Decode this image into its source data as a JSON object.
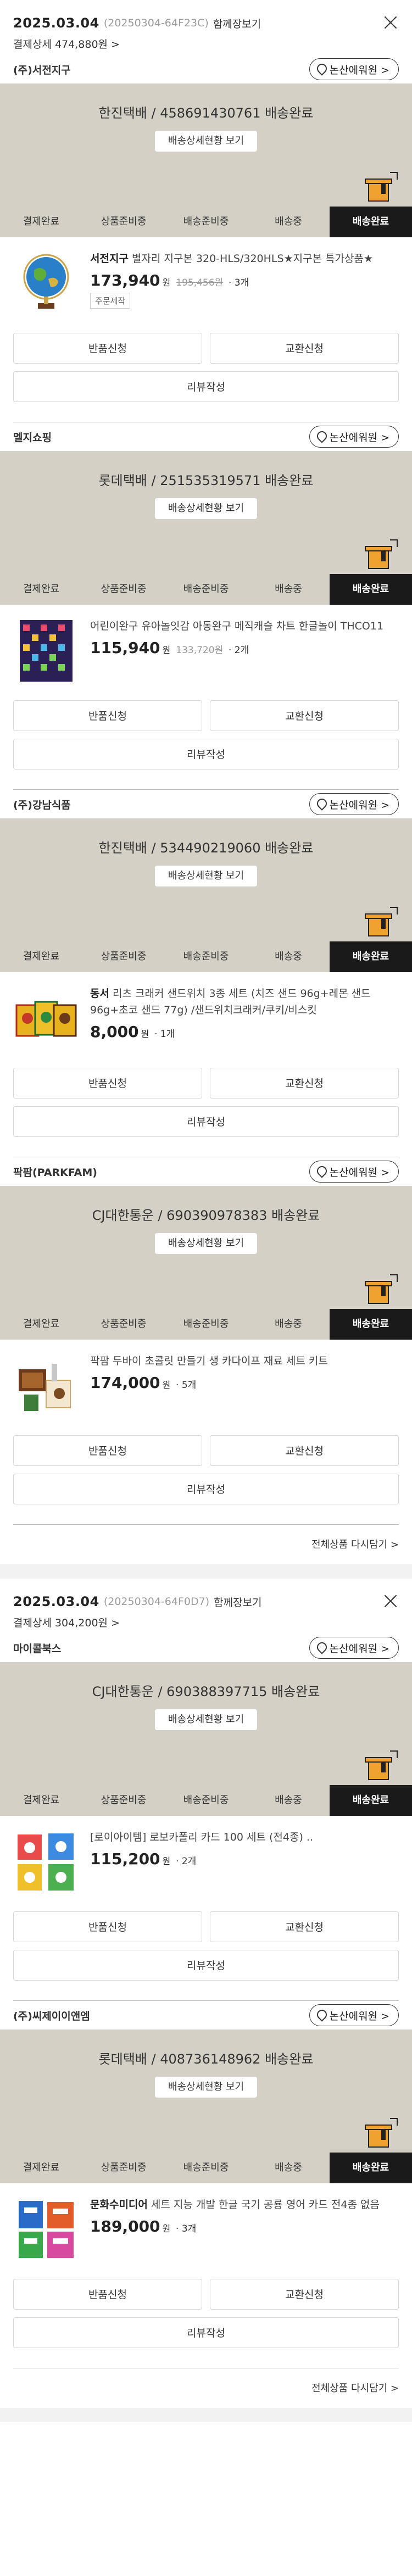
{
  "orders": [
    {
      "date": "2025.03.04",
      "number": "(20250304-64F23C)",
      "group_label": "함께장보기",
      "payment": "결제상세 474,880원 >",
      "more": "전체상품 다시담기 >",
      "sellers": [
        {
          "name": "(주)서전지구",
          "map": "논산에워원 >",
          "tracking": "한진택배 / 458691430761 배송완료",
          "track_btn": "배송상세현황 보기",
          "steps": [
            "결제완료",
            "상품준비중",
            "배송준비중",
            "배송중",
            "배송완료"
          ],
          "item": {
            "brand": "서전지구",
            "name": " 별자리 지구본 320-HLS/320HLS★지구본 특가상품★",
            "price": "173,940",
            "won": "원",
            "orig": "195,456원",
            "qty": "· 3개",
            "tag": "주문제작"
          },
          "buttons": [
            "반품신청",
            "교환신청",
            "리뷰작성"
          ]
        },
        {
          "name": "멜지쇼핑",
          "map": "논산에워원 >",
          "tracking": "롯데택배 / 251535319571 배송완료",
          "track_btn": "배송상세현황 보기",
          "steps": [
            "결제완료",
            "상품준비중",
            "배송준비중",
            "배송중",
            "배송완료"
          ],
          "item": {
            "brand": "",
            "name": "어린이완구 유아놀잇감 아동완구 메직캐슬 차트 한글놀이 THCO11",
            "price": "115,940",
            "won": "원",
            "orig": "133,720원",
            "qty": "· 2개",
            "tag": ""
          },
          "buttons": [
            "반품신청",
            "교환신청",
            "리뷰작성"
          ]
        },
        {
          "name": "(주)강남식품",
          "map": "논산에워원 >",
          "tracking": "한진택배 / 534490219060 배송완료",
          "track_btn": "배송상세현황 보기",
          "steps": [
            "결제완료",
            "상품준비중",
            "배송준비중",
            "배송중",
            "배송완료"
          ],
          "item": {
            "brand": "동서",
            "name": " 리츠 크래커 샌드위치 3종 세트 (치즈 샌드 96g+레몬 샌드 96g+초코 샌드 77g) /샌드위치크래커/쿠키/비스킷",
            "price": "8,000",
            "won": "원",
            "orig": "",
            "qty": "· 1개",
            "tag": ""
          },
          "buttons": [
            "반품신청",
            "교환신청",
            "리뷰작성"
          ]
        },
        {
          "name": "팍팜(PARKFAM)",
          "map": "논산에워원 >",
          "tracking": "CJ대한통운 / 690390978383 배송완료",
          "track_btn": "배송상세현황 보기",
          "steps": [
            "결제완료",
            "상품준비중",
            "배송준비중",
            "배송중",
            "배송완료"
          ],
          "item": {
            "brand": "",
            "name": "팍팜 두바이 초콜릿 만들기 생 카다이프 재료 세트 키트",
            "price": "174,000",
            "won": "원",
            "orig": "",
            "qty": "· 5개",
            "tag": ""
          },
          "buttons": [
            "반품신청",
            "교환신청",
            "리뷰작성"
          ]
        }
      ]
    },
    {
      "date": "2025.03.04",
      "number": "(20250304-64F0D7)",
      "group_label": "함께장보기",
      "payment": "결제상세 304,200원 >",
      "more": "전체상품 다시담기 >",
      "sellers": [
        {
          "name": "마이콜북스",
          "map": "논산에워원 >",
          "tracking": "CJ대한통운 / 690388397715 배송완료",
          "track_btn": "배송상세현황 보기",
          "steps": [
            "결제완료",
            "상품준비중",
            "배송준비중",
            "배송중",
            "배송완료"
          ],
          "item": {
            "brand": "",
            "name": "[로이아이템] 로보카폴리 카드 100 세트 (전4종) ..",
            "price": "115,200",
            "won": "원",
            "orig": "",
            "qty": "· 2개",
            "tag": ""
          },
          "buttons": [
            "반품신청",
            "교환신청",
            "리뷰작성"
          ]
        },
        {
          "name": "(주)씨제이이앤엠",
          "map": "논산에워원 >",
          "tracking": "롯데택배 / 408736148962 배송완료",
          "track_btn": "배송상세현황 보기",
          "steps": [
            "결제완료",
            "상품준비중",
            "배송준비중",
            "배송중",
            "배송완료"
          ],
          "item": {
            "brand": "문화수미디어",
            "name": " 세트 지능 개발 한글 국기 공룡 영어 카드 전4종 없음",
            "price": "189,000",
            "won": "원",
            "orig": "",
            "qty": "· 3개",
            "tag": ""
          },
          "buttons": [
            "반품신청",
            "교환신청",
            "리뷰작성"
          ]
        }
      ]
    }
  ]
}
